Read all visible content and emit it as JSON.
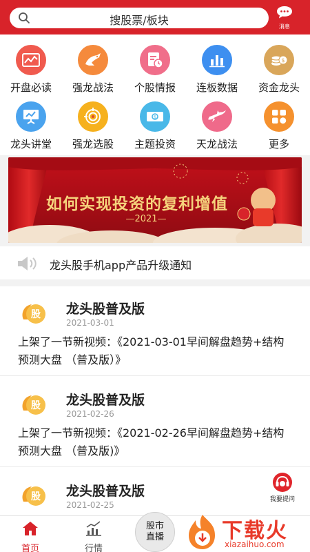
{
  "search": {
    "placeholder": "搜股票/板块"
  },
  "header": {
    "message_label": "消息"
  },
  "grid": {
    "items": [
      {
        "label": "开盘必读",
        "icon": "chart-card-icon",
        "color": "#f05a4e"
      },
      {
        "label": "强龙战法",
        "icon": "dragon-icon",
        "color": "#f58a3c"
      },
      {
        "label": "个股情报",
        "icon": "document-clock-icon",
        "color": "#f06e8a"
      },
      {
        "label": "连板数据",
        "icon": "bar-chart-icon",
        "color": "#3d8ff0"
      },
      {
        "label": "资金龙头",
        "icon": "coins-icon",
        "color": "#d9a65a"
      },
      {
        "label": "龙头讲堂",
        "icon": "presentation-icon",
        "color": "#4aa3ee"
      },
      {
        "label": "强龙选股",
        "icon": "target-icon",
        "color": "#f6b11e"
      },
      {
        "label": "主题投资",
        "icon": "money-icon",
        "color": "#49b8e8"
      },
      {
        "label": "天龙战法",
        "icon": "flying-dragon-icon",
        "color": "#ef6a8a"
      },
      {
        "label": "更多",
        "icon": "more-grid-icon",
        "color": "#f5912e"
      }
    ]
  },
  "banner": {
    "title": "如何实现投资的复利增值",
    "year": "—2021—"
  },
  "notice": {
    "text": "龙头股手机app产品升级通知"
  },
  "feed": {
    "cards": [
      {
        "title": "龙头股普及版",
        "date": "2021-03-01",
        "body": "上架了一节新视频：《2021-03-01早间解盘趋势+结构 预测大盘 （普及版）》"
      },
      {
        "title": "龙头股普及版",
        "date": "2021-02-26",
        "body": "上架了一节新视频：《2021-02-26早间解盘趋势+结构 预测大盘 （普及版)》"
      },
      {
        "title": "龙头股普及版",
        "date": "2021-02-25",
        "body": ""
      }
    ]
  },
  "ask": {
    "label": "我要提问"
  },
  "tabs": {
    "home": "首页",
    "market": "行情",
    "live": "股市直播"
  },
  "watermark": {
    "text": "下载火",
    "url": "xiazaihuo.com"
  },
  "colors": {
    "brand": "#d8232a",
    "accent": "#e83a2a"
  }
}
